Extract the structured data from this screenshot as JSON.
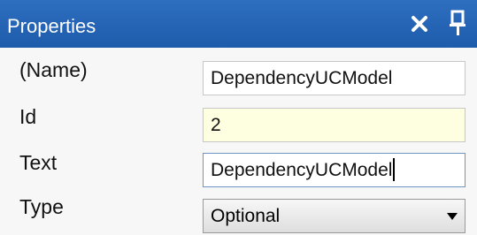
{
  "panel": {
    "title": "Properties",
    "accent_color": "#1d5bab",
    "icons": {
      "close": "close-icon",
      "pin": "pin-icon"
    }
  },
  "properties": [
    {
      "label": "(Name)",
      "value": "DependencyUCModel",
      "state": "normal"
    },
    {
      "label": "Id",
      "value": "2",
      "state": "readonly"
    },
    {
      "label": "Text",
      "value": "DependencyUCModel",
      "state": "focused"
    },
    {
      "label": "Type",
      "value": "Optional",
      "state": "dropdown"
    }
  ]
}
